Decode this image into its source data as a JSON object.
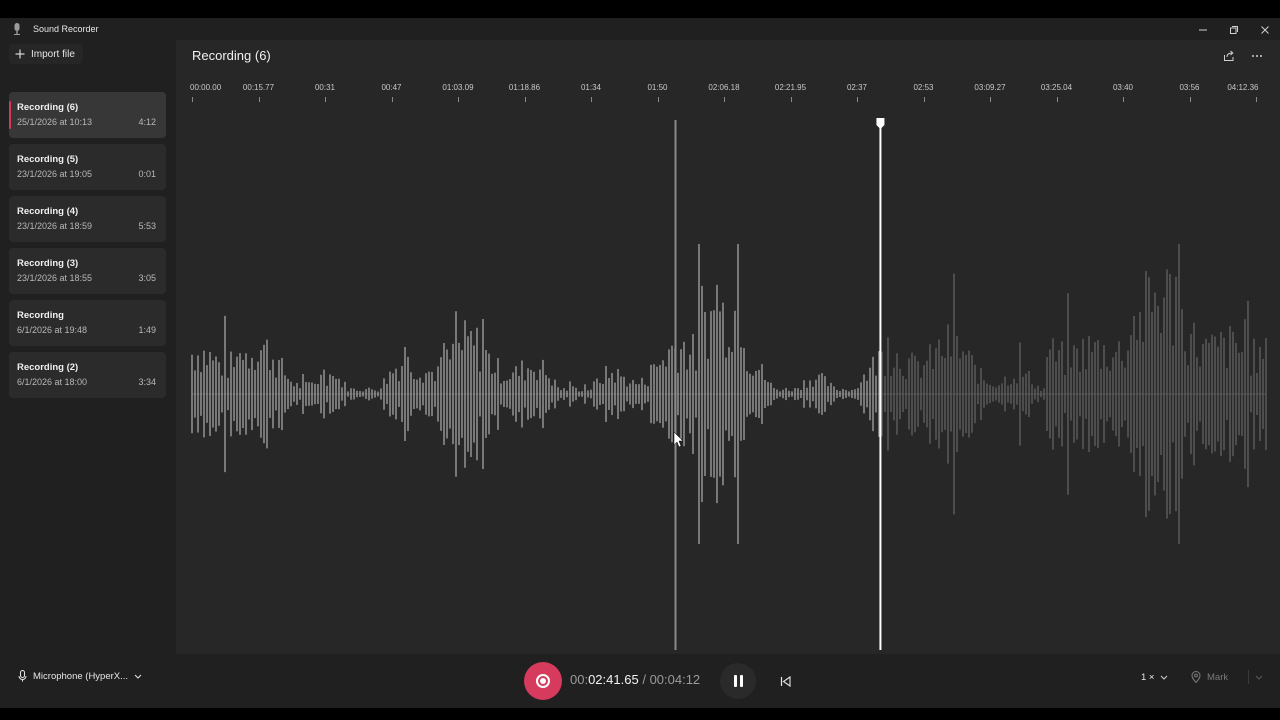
{
  "app": {
    "title": "Sound Recorder"
  },
  "sidebar": {
    "import_label": "Import file",
    "recordings": [
      {
        "name": "Recording (6)",
        "date": "25/1/2026 at 10:13",
        "duration": "4:12",
        "selected": true
      },
      {
        "name": "Recording (5)",
        "date": "23/1/2026 at 19:05",
        "duration": "0:01"
      },
      {
        "name": "Recording (4)",
        "date": "23/1/2026 at 18:59",
        "duration": "5:53"
      },
      {
        "name": "Recording (3)",
        "date": "23/1/2026 at 18:55",
        "duration": "3:05"
      },
      {
        "name": "Recording",
        "date": "6/1/2026 at 19:48",
        "duration": "1:49"
      },
      {
        "name": "Recording (2)",
        "date": "6/1/2026 at 18:00",
        "duration": "3:34"
      }
    ]
  },
  "main": {
    "title": "Recording (6)",
    "timeline": [
      "00:00.00",
      "00:15.77",
      "00:31",
      "00:47",
      "01:03.09",
      "01:18.86",
      "01:34",
      "01:50",
      "02:06.18",
      "02:21.95",
      "02:37",
      "02:53",
      "03:09.27",
      "03:25.04",
      "03:40",
      "03:56",
      "04:12.36"
    ]
  },
  "player": {
    "position_prefix": "00:",
    "position_main": "02:41.65",
    "separator": "/",
    "total": "00:04:12",
    "progress_fraction": 0.641,
    "speed": "1 ×",
    "mark_label": "Mark",
    "microphone": "Microphone (HyperX..."
  },
  "colors": {
    "accent": "#d63a5c",
    "background": "#202020",
    "panel": "#272727"
  },
  "icons": [
    "microphone-app-icon",
    "minimize-icon",
    "maximize-icon",
    "close-icon",
    "plus-icon",
    "share-icon",
    "more-icon",
    "playhead-icon",
    "microphone-icon",
    "chevron-down-icon",
    "record-icon",
    "pause-icon",
    "restart-icon",
    "mark-pin-icon"
  ]
}
